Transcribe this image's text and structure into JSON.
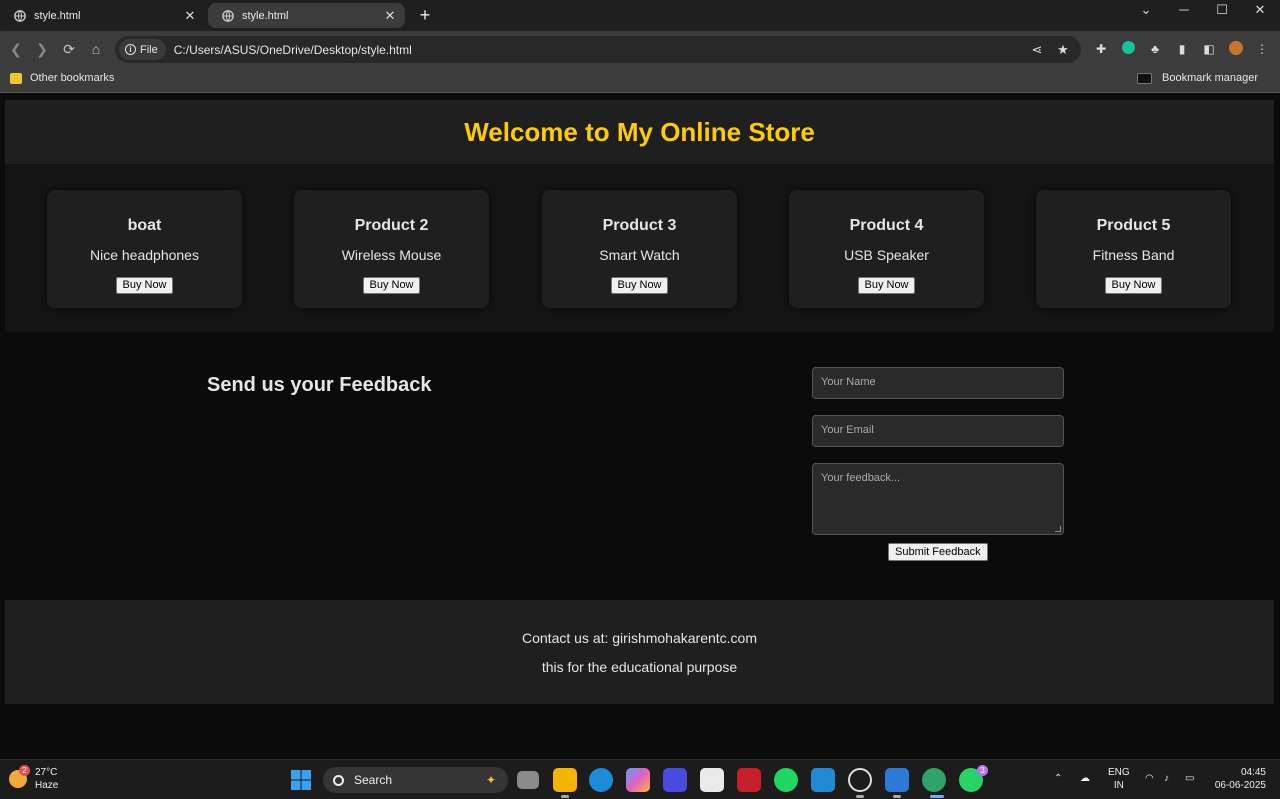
{
  "browser": {
    "tabs": [
      {
        "title": "style.html",
        "active": false
      },
      {
        "title": "style.html",
        "active": true
      }
    ],
    "address": {
      "scheme_chip": "File",
      "url": "C:/Users/ASUS/OneDrive/Desktop/style.html"
    },
    "bookmarks_bar": {
      "left": "Other bookmarks",
      "right": "Bookmark manager"
    }
  },
  "page": {
    "header_title": "Welcome to My Online Store",
    "accent_color": "#ffcc00",
    "products": [
      {
        "name": "boat",
        "desc": "Nice headphones",
        "button": "Buy Now"
      },
      {
        "name": "Product 2",
        "desc": "Wireless Mouse",
        "button": "Buy Now"
      },
      {
        "name": "Product 3",
        "desc": "Smart Watch",
        "button": "Buy Now"
      },
      {
        "name": "Product 4",
        "desc": "USB Speaker",
        "button": "Buy Now"
      },
      {
        "name": "Product 5",
        "desc": "Fitness Band",
        "button": "Buy Now"
      }
    ],
    "feedback": {
      "heading": "Send us your Feedback",
      "name_placeholder": "Your Name",
      "email_placeholder": "Your Email",
      "message_placeholder": "Your feedback...",
      "submit": "Submit Feedback"
    },
    "footer": {
      "contact": "Contact us at: girishmohakarentc.com",
      "note": "this for the educational purpose"
    }
  },
  "taskbar": {
    "weather": {
      "temp": "27°C",
      "condition": "Haze",
      "badge": "2"
    },
    "search_label": "Search",
    "lang": {
      "line1": "ENG",
      "line2": "IN"
    },
    "clock": {
      "time": "04:45",
      "date": "06-06-2025"
    },
    "whatsapp_badge": "3"
  }
}
